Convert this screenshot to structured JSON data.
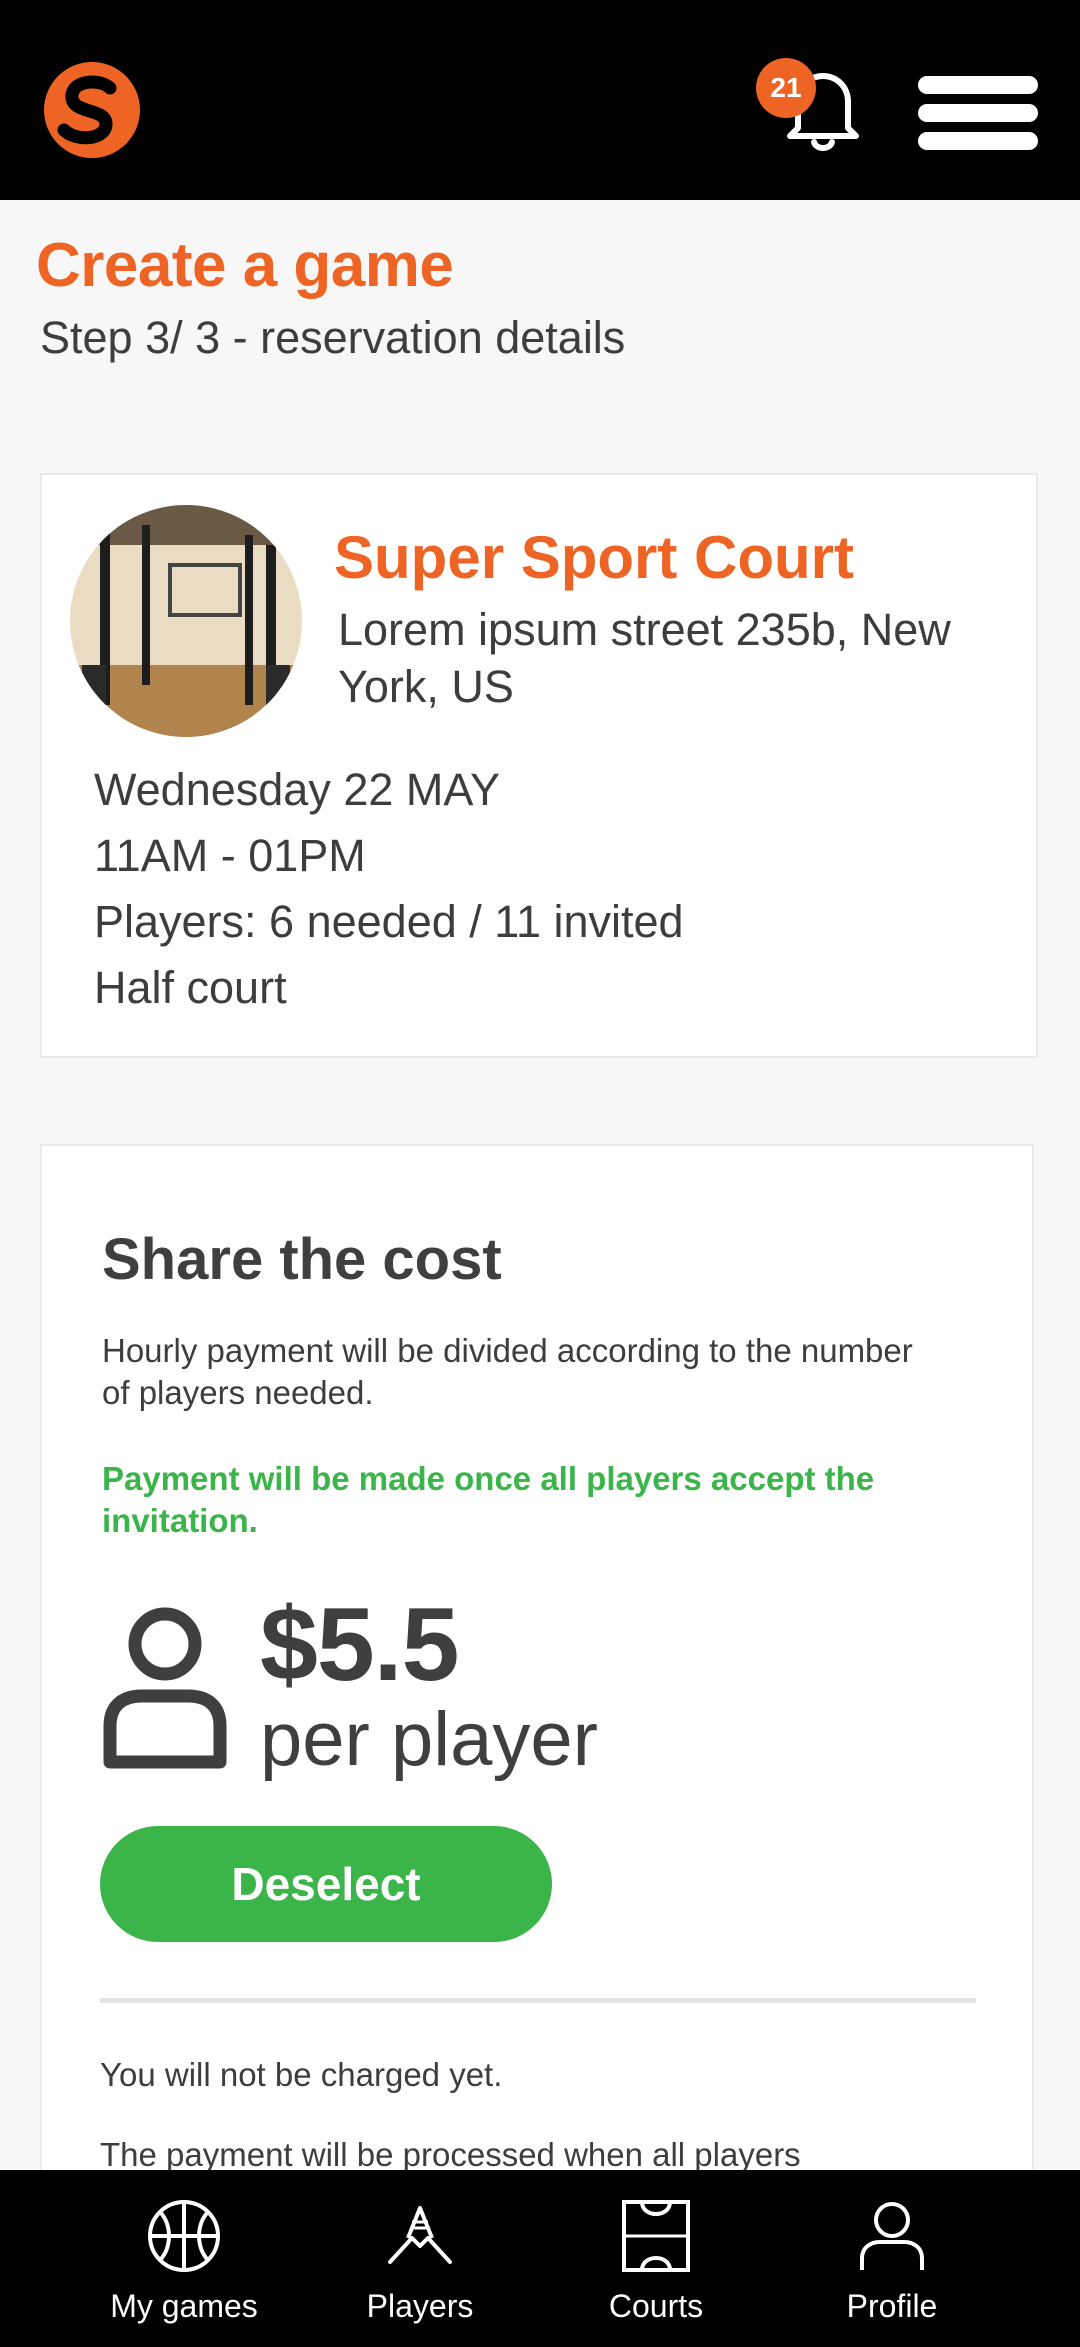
{
  "header": {
    "logo_name": "s-logo",
    "notification_count": "21",
    "icons": [
      "bell-icon",
      "hamburger-menu-icon"
    ]
  },
  "page": {
    "title": "Create a game",
    "subtitle": "Step 3/ 3  - reservation details"
  },
  "reservation": {
    "court_name": "Super Sport Court",
    "address": "Lorem ipsum street  235b, New York, US",
    "date": "Wednesday 22 MAY",
    "time": "11AM - 01PM",
    "players": "Players: 6 needed / 11 invited",
    "court_type": "Half court"
  },
  "cost": {
    "title": "Share the cost",
    "description": "Hourly payment will be divided according to the number of players needed.",
    "note": "Payment will be made once all players accept the invitation.",
    "price": "$5.5",
    "price_unit": "per player",
    "button_label": "Deselect",
    "charge_note": "You will not be charged yet.",
    "processed_note": "The payment will be processed when all players"
  },
  "bottom_nav": {
    "items": [
      {
        "label": "My games",
        "icon": "basketball-icon"
      },
      {
        "label": "Players",
        "icon": "handshake-icon"
      },
      {
        "label": "Courts",
        "icon": "court-icon"
      },
      {
        "label": "Profile",
        "icon": "person-icon"
      }
    ]
  },
  "colors": {
    "accent": "#ee6424",
    "success": "#3bb54a",
    "header_bg": "#000000"
  }
}
